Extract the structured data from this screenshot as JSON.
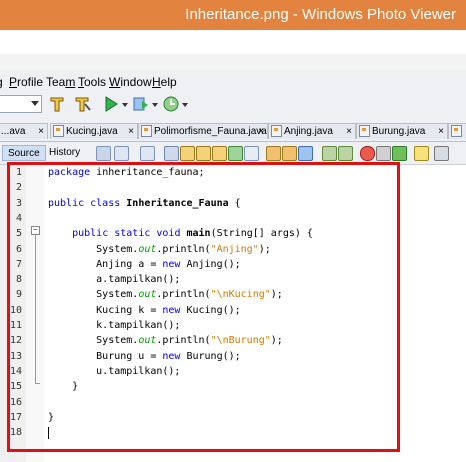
{
  "window": {
    "title": "Inheritance.png - Windows Photo Viewer"
  },
  "menu": [
    {
      "label": "g",
      "underline": ""
    },
    {
      "label": "Profile",
      "underline": "P"
    },
    {
      "label": "Team",
      "underline": "m"
    },
    {
      "label": "Tools",
      "underline": "T"
    },
    {
      "label": "Window",
      "underline": "W"
    },
    {
      "label": "Help",
      "underline": "H"
    }
  ],
  "tabs": [
    {
      "label": "...ava",
      "close": "×"
    },
    {
      "label": "Kucing.java",
      "close": "×"
    },
    {
      "label": "Polimorfisme_Fauna.java",
      "close": "×"
    },
    {
      "label": "Anjing.java",
      "close": "×"
    },
    {
      "label": "Burung.java",
      "close": "×"
    }
  ],
  "editor_tabs": {
    "source": "Source",
    "history": "History"
  },
  "code_lines": [
    {
      "n": "1",
      "html": "<span class=\"kw\">package</span> inheritance_fauna;"
    },
    {
      "n": "2",
      "html": ""
    },
    {
      "n": "3",
      "html": "<span class=\"kw\">public class</span> <span class=\"bold\">Inheritance_Fauna</span> {"
    },
    {
      "n": "4",
      "html": ""
    },
    {
      "n": "5",
      "html": "    <span class=\"kw\">public static void</span> <span class=\"bold\">main</span>(String[] args) {"
    },
    {
      "n": "6",
      "html": "        System.<span class=\"fld\">out</span>.println(<span class=\"str\">\"Anjing\"</span>);"
    },
    {
      "n": "7",
      "html": "        Anjing a = <span class=\"kw\">new</span> Anjing();"
    },
    {
      "n": "8",
      "html": "        a.tampilkan();"
    },
    {
      "n": "9",
      "html": "        System.<span class=\"fld\">out</span>.println(<span class=\"str\">\"\\nKucing\"</span>);"
    },
    {
      "n": "10",
      "html": "        Kucing k = <span class=\"kw\">new</span> Kucing();"
    },
    {
      "n": "11",
      "html": "        k.tampilkan();"
    },
    {
      "n": "12",
      "html": "        System.<span class=\"fld\">out</span>.println(<span class=\"str\">\"\\nBurung\"</span>);"
    },
    {
      "n": "13",
      "html": "        Burung u = <span class=\"kw\">new</span> Burung();"
    },
    {
      "n": "14",
      "html": "        u.tampilkan();"
    },
    {
      "n": "15",
      "html": "    }"
    },
    {
      "n": "16",
      "html": ""
    },
    {
      "n": "17",
      "html": "}"
    },
    {
      "n": "18",
      "html": ""
    }
  ],
  "colors": {
    "title_bar": "#e2843f",
    "highlight_box": "#e01010",
    "keyword": "#0000e6",
    "string": "#ce7b00",
    "field": "#009900"
  }
}
